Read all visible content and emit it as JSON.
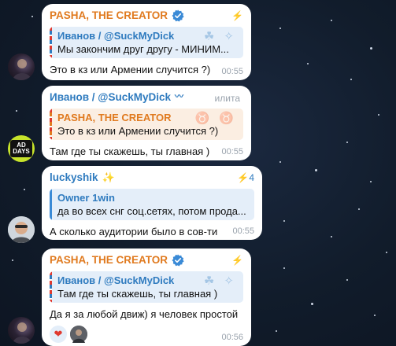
{
  "messages": [
    {
      "sender": "PASHA, THE CREATOR",
      "reply_name": "Иванов / @SuckMyDick",
      "reply_text": "Мы закончим друг другу - МИНИМ...",
      "text": "Это в кз или Армении случится ?)",
      "time": "00:55"
    },
    {
      "sender": "Иванов / @SuckMyDick",
      "status": "илита",
      "reply_name": "PASHA, THE CREATOR",
      "reply_text": "Это в кз или Армении случится ?)",
      "text": "Там где ты скажешь, ты главная )",
      "time": "00:55",
      "avatar_text": "AD\nDAYS"
    },
    {
      "sender": "luckyshik",
      "boost_count": "4",
      "reply_name": "Owner 1win",
      "reply_text": "да во всех снг соц.сетях, потом прода...",
      "text": "А сколько аудитории было в сов-ти",
      "time": "00:55"
    },
    {
      "sender": "PASHA, THE CREATOR",
      "reply_name": "Иванов / @SuckMyDick",
      "reply_text": "Там где ты скажешь, ты главная )",
      "text": "Да я за любой движ) я человек простой",
      "time": "00:56",
      "reactions": [
        "heart-reaction",
        "user-avatar-reaction"
      ]
    }
  ],
  "colors": {
    "accent_orange": "#e07a1f",
    "accent_blue": "#2f7bbf",
    "background": "#111c2b"
  }
}
